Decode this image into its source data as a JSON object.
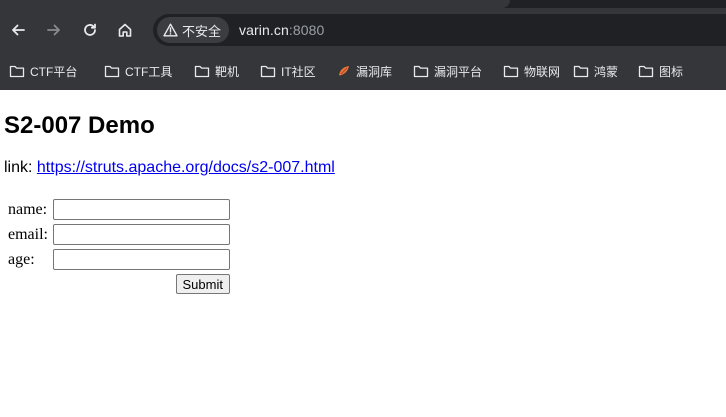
{
  "browser": {
    "security_label": "不安全",
    "url_host": "varin.cn",
    "url_port": ":8080",
    "bookmarks": [
      {
        "label": "CTF平台",
        "icon": "folder-icon"
      },
      {
        "label": "CTF工具",
        "icon": "folder-icon"
      },
      {
        "label": "靶机",
        "icon": "folder-icon"
      },
      {
        "label": "IT社区",
        "icon": "folder-icon"
      },
      {
        "label": "漏洞库",
        "icon": "vuln-db-favicon-icon"
      },
      {
        "label": "漏洞平台",
        "icon": "folder-icon"
      },
      {
        "label": "物联网",
        "icon": "folder-icon"
      },
      {
        "label": "鸿蒙",
        "icon": "folder-icon"
      },
      {
        "label": "图标",
        "icon": "folder-icon"
      }
    ]
  },
  "page": {
    "title": "S2-007 Demo",
    "link_prefix": "link: ",
    "link_text": "https://struts.apache.org/docs/s2-007.html",
    "form": {
      "name_label": "name:",
      "name_value": "",
      "email_label": "email:",
      "email_value": "",
      "age_label": "age:",
      "age_value": "",
      "submit_label": "Submit"
    }
  },
  "colors": {
    "toolbar_bg": "#35363a",
    "omnibox_bg": "#202124",
    "link": "#0000ee"
  }
}
